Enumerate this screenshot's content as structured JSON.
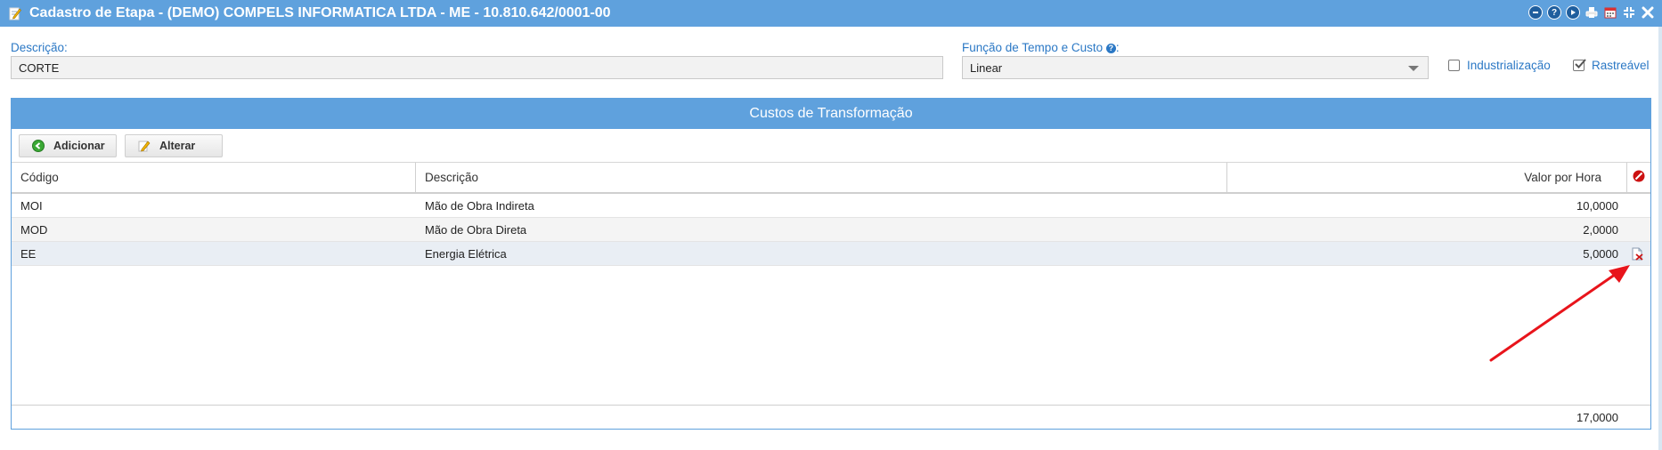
{
  "window": {
    "title": "Cadastro de Etapa - (DEMO) COMPELS INFORMATICA LTDA - ME - 10.810.642/0001-00",
    "controls": [
      "minimize-icon",
      "help-icon",
      "play-icon",
      "print-icon",
      "calendar-icon",
      "collapse-icon",
      "close-icon"
    ]
  },
  "form": {
    "descricao_label": "Descrição:",
    "descricao_value": "CORTE",
    "funcao_label": "Função de Tempo e Custo",
    "funcao_colon": ":",
    "funcao_value": "Linear",
    "industrializacao_label": "Industrialização",
    "industrializacao_checked": false,
    "rastreavel_label": "Rastreável",
    "rastreavel_checked": true
  },
  "panel": {
    "title": "Custos de Transformação",
    "add_label": "Adicionar",
    "edit_label": "Alterar"
  },
  "table": {
    "columns": [
      "Código",
      "Descrição",
      "Valor por Hora"
    ],
    "rows": [
      {
        "codigo": "MOI",
        "descricao": "Mão de Obra Indireta",
        "valor": "10,0000"
      },
      {
        "codigo": "MOD",
        "descricao": "Mão de Obra Direta",
        "valor": "2,0000"
      },
      {
        "codigo": "EE",
        "descricao": "Energia Elétrica",
        "valor": "5,0000"
      }
    ],
    "total": "17,0000"
  },
  "colors": {
    "accent": "#5fa1dd",
    "label": "#2b78c5",
    "annotation_arrow": "#e8141b",
    "delete_icon": "#cc1111",
    "add_icon": "#3aa935"
  }
}
